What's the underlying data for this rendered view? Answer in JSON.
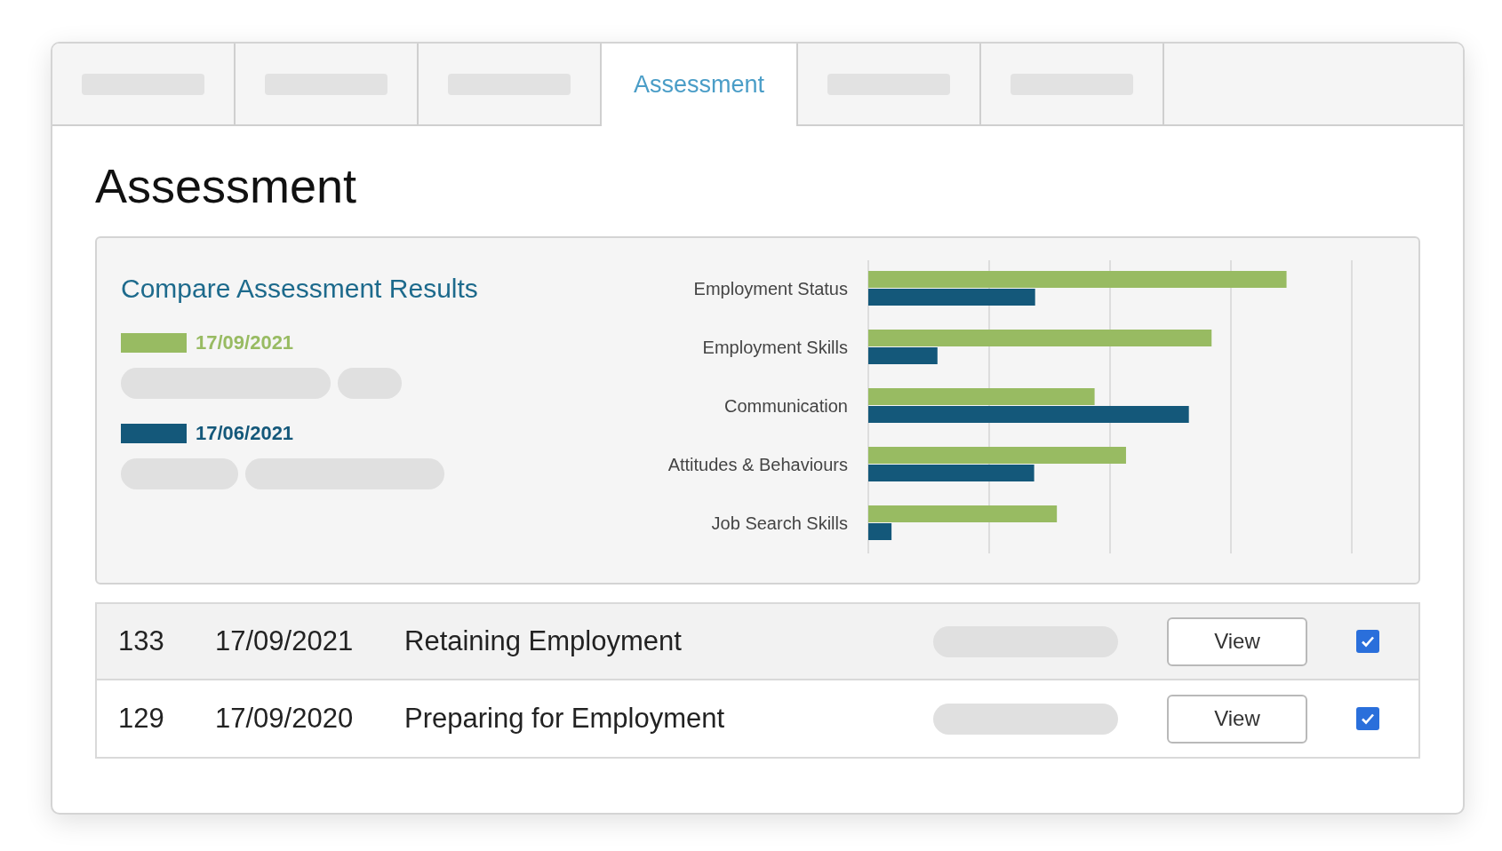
{
  "tabs": [
    {
      "kind": "placeholder",
      "selected": false
    },
    {
      "kind": "placeholder",
      "selected": false
    },
    {
      "kind": "placeholder",
      "selected": false
    },
    {
      "kind": "label",
      "label": "Assessment",
      "selected": true
    },
    {
      "kind": "placeholder",
      "selected": false
    },
    {
      "kind": "placeholder",
      "selected": false
    }
  ],
  "page_title": "Assessment",
  "compare": {
    "title": "Compare Assessment Results",
    "legend": [
      {
        "date": "17/09/2021",
        "color": "#98bb62"
      },
      {
        "date": "17/06/2021",
        "color": "#14587a"
      }
    ],
    "categories": [
      "Employment Status",
      "Employment Skills",
      "Communication",
      "Attitudes & Behaviours",
      "Job Search Skills"
    ]
  },
  "rows": [
    {
      "id": "133",
      "date": "17/09/2021",
      "name": "Retaining Employment",
      "button": "View",
      "checked": true
    },
    {
      "id": "129",
      "date": "17/09/2020",
      "name": "Preparing for Employment",
      "button": "View",
      "checked": true
    }
  ]
}
